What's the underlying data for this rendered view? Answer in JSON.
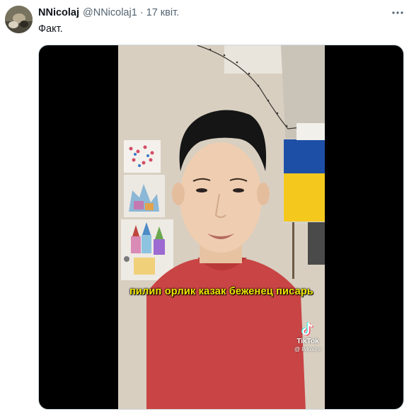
{
  "tweet": {
    "author_name": "NNicolaj",
    "author_handle": "@NNicolaj1",
    "separator": "·",
    "date": "17 квіт.",
    "text": "Факт."
  },
  "media": {
    "caption": "пилип орлик казак беженец писарь",
    "watermark_brand": "TikTok",
    "watermark_user": "@ livkadre"
  },
  "icons": {
    "more": "more-horizontal-icon",
    "tiktok": "tiktok-logo-icon"
  },
  "colors": {
    "caption": "#f2e800",
    "shirt": "#c94444",
    "flag_blue": "#1d4fa6",
    "flag_yellow": "#f5c81e"
  }
}
